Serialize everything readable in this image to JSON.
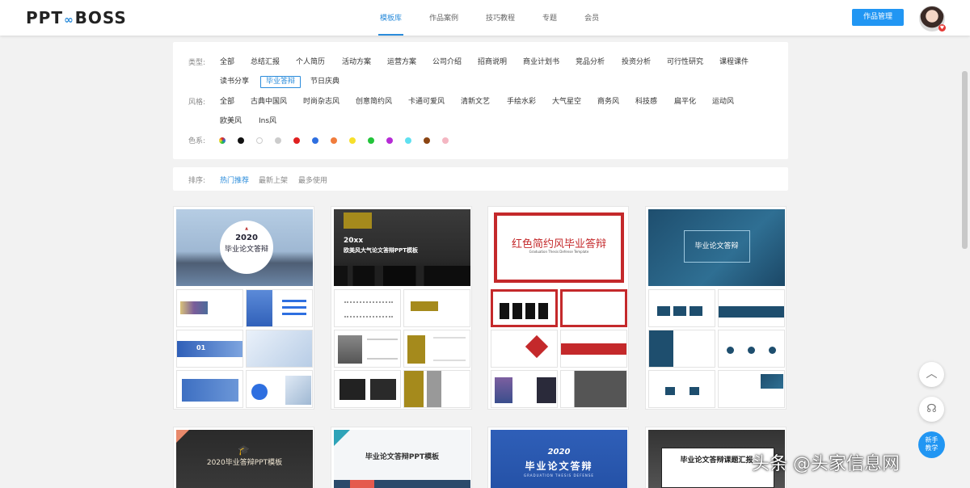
{
  "brand": {
    "logo_left": "PPT",
    "logo_link": "∞",
    "logo_right": "BOSS"
  },
  "nav": {
    "items": [
      "模板库",
      "作品案例",
      "技巧教程",
      "专题",
      "会员"
    ],
    "active": "模板库"
  },
  "header": {
    "work_button": "作品管理"
  },
  "filters": {
    "type_label": "类型:",
    "types": [
      "全部",
      "总结汇报",
      "个人简历",
      "活动方案",
      "运营方案",
      "公司介绍",
      "招商说明",
      "商业计划书",
      "竞品分析",
      "投资分析",
      "可行性研究",
      "课程课件",
      "读书分享",
      "毕业答辩",
      "节日庆典"
    ],
    "type_selected": "毕业答辩",
    "style_label": "风格:",
    "styles": [
      "全部",
      "古典中国风",
      "时尚杂志风",
      "创意简约风",
      "卡通可爱风",
      "清新文艺",
      "手绘水彩",
      "大气星空",
      "商务风",
      "科技感",
      "扁平化",
      "运动风",
      "欧美风",
      "Ins风"
    ],
    "color_label": "色系:",
    "colors": [
      "gradient",
      "#111111",
      "#ffffff",
      "#cccccc",
      "#e02020",
      "#2e6fe0",
      "#f07c3c",
      "#f7e02b",
      "#22c43a",
      "#b62bd6",
      "#5fe0f0",
      "#8b4513",
      "#f4b6c2"
    ]
  },
  "sort": {
    "label": "排序:",
    "options": [
      "热门推荐",
      "最新上架",
      "最多使用"
    ],
    "active": "热门推荐"
  },
  "cards": [
    {
      "year": "2020",
      "title": "毕业论文答辩",
      "num": "01"
    },
    {
      "year": "20xx",
      "title": "欧美风大气论文答辩PPT模板"
    },
    {
      "title": "红色简约风毕业答辩",
      "subtitle": "Graduation Thesis Defense Template"
    },
    {
      "title": "毕业论文答辩"
    }
  ],
  "cards_row2": [
    {
      "title": "2020毕业答辩PPT模板"
    },
    {
      "title": "毕业论文答辩PPT模板"
    },
    {
      "year": "2020",
      "title": "毕业论文答辩",
      "subtitle": "GRADUATION THESIS DEFENSE"
    },
    {
      "title": "毕业论文答辩课题汇报"
    }
  ],
  "side": {
    "new_line1": "新手",
    "new_line2": "教学"
  },
  "watermark": "头条 @头家信息网"
}
